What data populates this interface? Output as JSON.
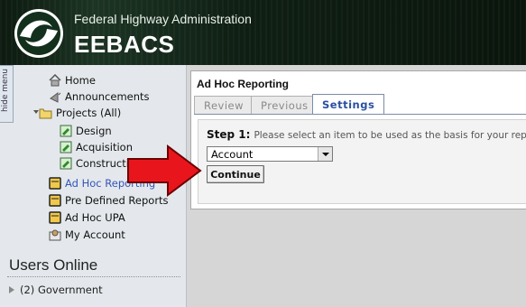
{
  "header": {
    "agency": "Federal Highway Administration",
    "app_name": "EEBACS",
    "logo_icon": "fhwa-logo-icon"
  },
  "sidebar": {
    "hide_menu_label": "hide menu",
    "items": [
      {
        "label": "Home",
        "icon": "home-icon"
      },
      {
        "label": "Announcements",
        "icon": "announcement-icon"
      },
      {
        "label": "Projects (All)",
        "icon": "folder-icon"
      },
      {
        "label": "Design",
        "icon": "doc-edit-icon"
      },
      {
        "label": "Acquisition",
        "icon": "doc-edit-icon"
      },
      {
        "label": "Construction",
        "icon": "doc-edit-icon"
      },
      {
        "label": "Ad Hoc Reporting",
        "icon": "report-icon",
        "active": true
      },
      {
        "label": "Pre Defined Reports",
        "icon": "report-icon"
      },
      {
        "label": "Ad Hoc UPA",
        "icon": "report-icon"
      },
      {
        "label": "My Account",
        "icon": "account-icon"
      }
    ],
    "users_online": {
      "heading": "Users Online",
      "items": [
        {
          "label": "(2) Government"
        }
      ]
    }
  },
  "main": {
    "panel_title": "Ad Hoc Reporting",
    "tabs": [
      {
        "label": "Review",
        "active": false
      },
      {
        "label": "Previous",
        "active": false
      },
      {
        "label": "Settings",
        "active": true
      }
    ],
    "step_label": "Step 1:",
    "step_text": "Please select an item to be used as the basis for your report.",
    "select_value": "Account",
    "continue_label": "Continue"
  },
  "colors": {
    "header_bg": "#0f1f13",
    "sidebar_bg": "#e4e8ec",
    "active_link": "#3655b8",
    "tab_active_text": "#2a4fa0",
    "callout_arrow": "#e8161c"
  }
}
